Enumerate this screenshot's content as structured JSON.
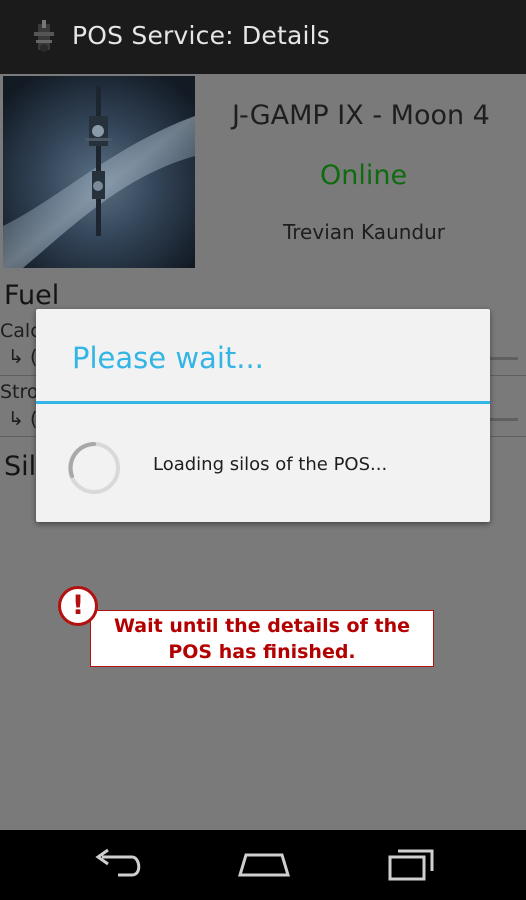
{
  "actionbar": {
    "title": "POS Service: Details",
    "icon": "pos-station-icon"
  },
  "pos": {
    "name": "J-GAMP IX - Moon 4",
    "status": "Online",
    "status_color": "#0f6b0f",
    "owner": "Trevian Kaundur"
  },
  "sections": {
    "fuel": "Fuel",
    "row1_label": "Calc",
    "row1_sub": "↳ (",
    "row2_label": "Stro",
    "row2_sub": "↳ (",
    "silos": "Sil"
  },
  "dialog": {
    "title": "Please wait...",
    "message": "Loading silos of the POS...",
    "accent": "#33b5e5"
  },
  "annotation": {
    "icon": "exclamation-icon",
    "line1": "Wait until the details of the",
    "line2": "POS has finished.",
    "color": "#b30000"
  },
  "navbar": {
    "icons": [
      "back-icon",
      "home-icon",
      "recent-apps-icon"
    ]
  }
}
